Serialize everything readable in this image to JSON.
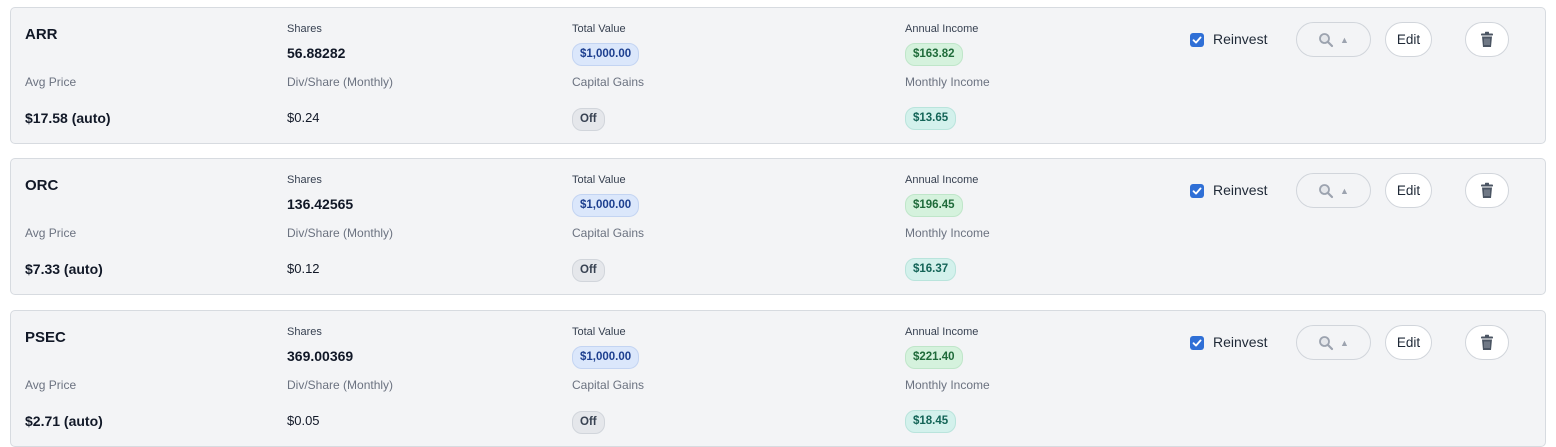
{
  "labels": {
    "shares": "Shares",
    "total_value": "Total Value",
    "annual_income": "Annual Income",
    "avg_price": "Avg Price",
    "div_share": "Div/Share (Monthly)",
    "capital_gains": "Capital Gains",
    "monthly_income": "Monthly Income",
    "reinvest": "Reinvest",
    "edit": "Edit"
  },
  "icons": {
    "search": "magnifier-icon",
    "caret": "caret-up-icon",
    "delete": "trash-icon",
    "checkbox": "checkmark-icon"
  },
  "colors": {
    "accent_blue": "#2f6fd6",
    "card_bg": "#f3f4f6",
    "total_value_pill": "#dbe7fb",
    "annual_income_pill": "#d5f2dd",
    "monthly_income_pill": "#d3f1ec",
    "capital_gains_pill": "#e5e7eb"
  },
  "holdings": [
    {
      "ticker": "ARR",
      "shares": "56.88282",
      "total_value": "$1,000.00",
      "annual_income": "$163.82",
      "avg_price": "$17.58 (auto)",
      "div_share": "$0.24",
      "capital_gains": "Off",
      "monthly_income": "$13.65",
      "reinvest": true
    },
    {
      "ticker": "ORC",
      "shares": "136.42565",
      "total_value": "$1,000.00",
      "annual_income": "$196.45",
      "avg_price": "$7.33 (auto)",
      "div_share": "$0.12",
      "capital_gains": "Off",
      "monthly_income": "$16.37",
      "reinvest": true
    },
    {
      "ticker": "PSEC",
      "shares": "369.00369",
      "total_value": "$1,000.00",
      "annual_income": "$221.40",
      "avg_price": "$2.71 (auto)",
      "div_share": "$0.05",
      "capital_gains": "Off",
      "monthly_income": "$18.45",
      "reinvest": true
    }
  ]
}
